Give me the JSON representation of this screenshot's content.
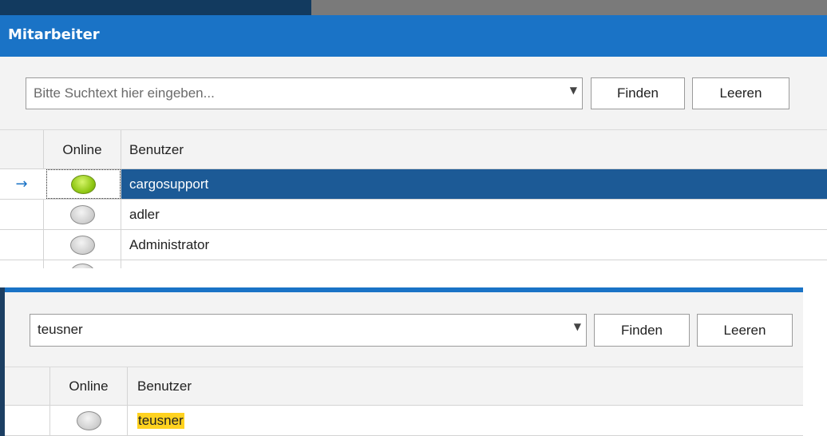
{
  "window": {
    "title": "Mitarbeiter"
  },
  "panel1": {
    "search": {
      "value": "",
      "placeholder": "Bitte Suchtext hier eingeben..."
    },
    "find_label": "Finden",
    "clear_label": "Leeren",
    "columns": {
      "online": "Online",
      "user": "Benutzer"
    },
    "row_indicator": "→",
    "rows": [
      {
        "online": true,
        "user": "cargosupport"
      },
      {
        "online": false,
        "user": "adler"
      },
      {
        "online": false,
        "user": "Administrator"
      }
    ]
  },
  "panel2": {
    "search": {
      "value": "teusner"
    },
    "find_label": "Finden",
    "clear_label": "Leeren",
    "columns": {
      "online": "Online",
      "user": "Benutzer"
    },
    "rows": [
      {
        "online": false,
        "user": "teusner"
      }
    ]
  },
  "icons": {
    "dropdown": "chevron-down-icon",
    "indicator": "arrow-right-icon"
  },
  "colors": {
    "accent": "#1a73c6",
    "selection": "#1c5a96",
    "online": "#8cc510",
    "offline": "#cfcfcf",
    "match_highlight": "#ffd21f"
  }
}
